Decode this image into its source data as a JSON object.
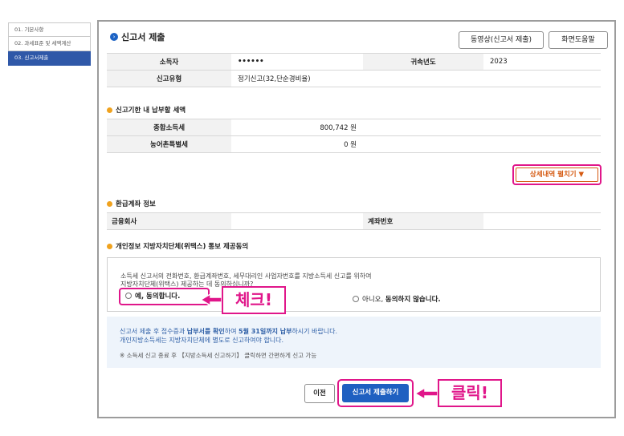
{
  "sidebar": {
    "items": [
      {
        "label": "01. 기본사항"
      },
      {
        "label": "02. 과세표준 및 세액계산"
      },
      {
        "label": "03. 신고서제출"
      }
    ]
  },
  "header": {
    "title": "신고서 제출",
    "video_button": "동영상(신고서 제출)",
    "help_button": "화면도움말"
  },
  "info": {
    "taxpayer_label": "소득자",
    "taxpayer_value": "••••••",
    "year_label": "귀속년도",
    "year_value": "2023",
    "type_label": "신고유형",
    "type_value": "정기신고(32,단순경비율)"
  },
  "tax_due": {
    "section_title": "신고기한 내 납부할 세액",
    "rows": [
      {
        "label": "종합소득세",
        "value": "800,742 원"
      },
      {
        "label": "농어촌특별세",
        "value": "0 원"
      }
    ],
    "detail_button": "상세내역 펼치기 ▼"
  },
  "refund": {
    "section_title": "환급계좌 정보",
    "bank_label": "금융회사",
    "account_label": "계좌번호"
  },
  "consent": {
    "section_title": "개인정보 지방자치단체(위택스) 통보 제공동의",
    "text_line1": "소득세 신고서의 전화번호, 환급계좌번호, 세무대리인 사업자번호를 지방소득세 신고를 위하여",
    "text_line2": "지방자치단체(위택스) 제공하는 데 동의하십니까?",
    "yes_label": "예, 동의합니다.",
    "no_prefix": "아니오, ",
    "no_label": "동의하지 않습니다."
  },
  "notice": {
    "line1_a": "신고서 제출 후 접수증과 ",
    "line1_b": "납부서를 확인",
    "line1_c": "하여 ",
    "line1_d": "5월 31일까지 납부",
    "line1_e": "하시기 바랍니다.",
    "line2": "개인지방소득세는 지방자치단체에 별도로 신고하여야 합니다.",
    "line3": "※ 소득세 신고 종료 후 【지방소득세 신고하기】 클릭하면 간편하게 신고 가능"
  },
  "actions": {
    "prev_button": "이전",
    "submit_button": "신고서 제출하기"
  },
  "annotations": {
    "check_label": "체크!",
    "click_label": "클릭!"
  },
  "colors": {
    "accent_magenta": "#e0168a",
    "primary_blue": "#1f60c1",
    "section_orange": "#f0a21e"
  }
}
